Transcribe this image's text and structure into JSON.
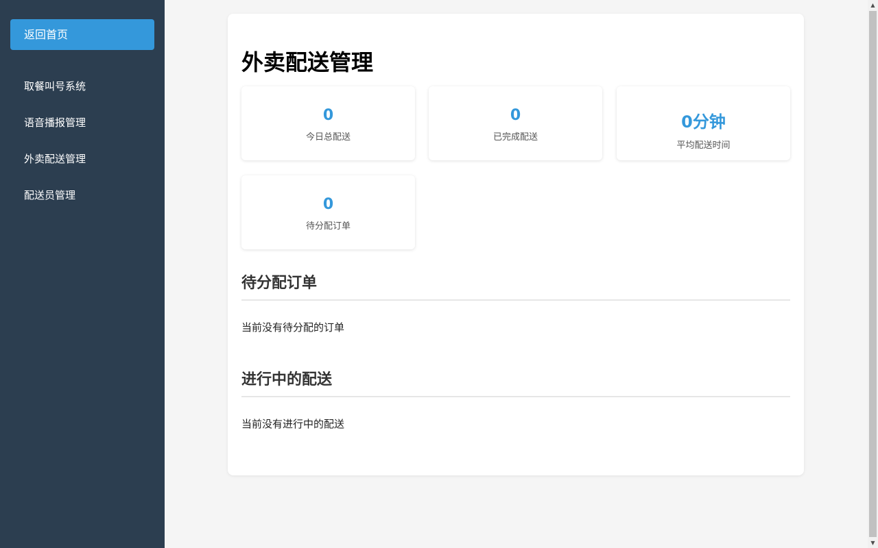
{
  "sidebar": {
    "home_label": "返回首页",
    "items": [
      {
        "label": "取餐叫号系统"
      },
      {
        "label": "语音播报管理"
      },
      {
        "label": "外卖配送管理"
      },
      {
        "label": "配送员管理"
      }
    ]
  },
  "page": {
    "title": "外卖配送管理",
    "stats": [
      {
        "value": "0",
        "label": "今日总配送"
      },
      {
        "value": "0",
        "label": "已完成配送"
      },
      {
        "value": "0分钟",
        "label": "平均配送时间"
      },
      {
        "value": "0",
        "label": "待分配订单"
      }
    ],
    "sections": [
      {
        "title": "待分配订单",
        "empty_text": "当前没有待分配的订单"
      },
      {
        "title": "进行中的配送",
        "empty_text": "当前没有进行中的配送"
      }
    ]
  },
  "icons": {
    "scroll_up": "scroll-up-icon",
    "scroll_down": "scroll-down-icon"
  },
  "colors": {
    "sidebar_bg": "#2c3e50",
    "accent": "#3498db",
    "page_bg": "#f5f5f5"
  }
}
